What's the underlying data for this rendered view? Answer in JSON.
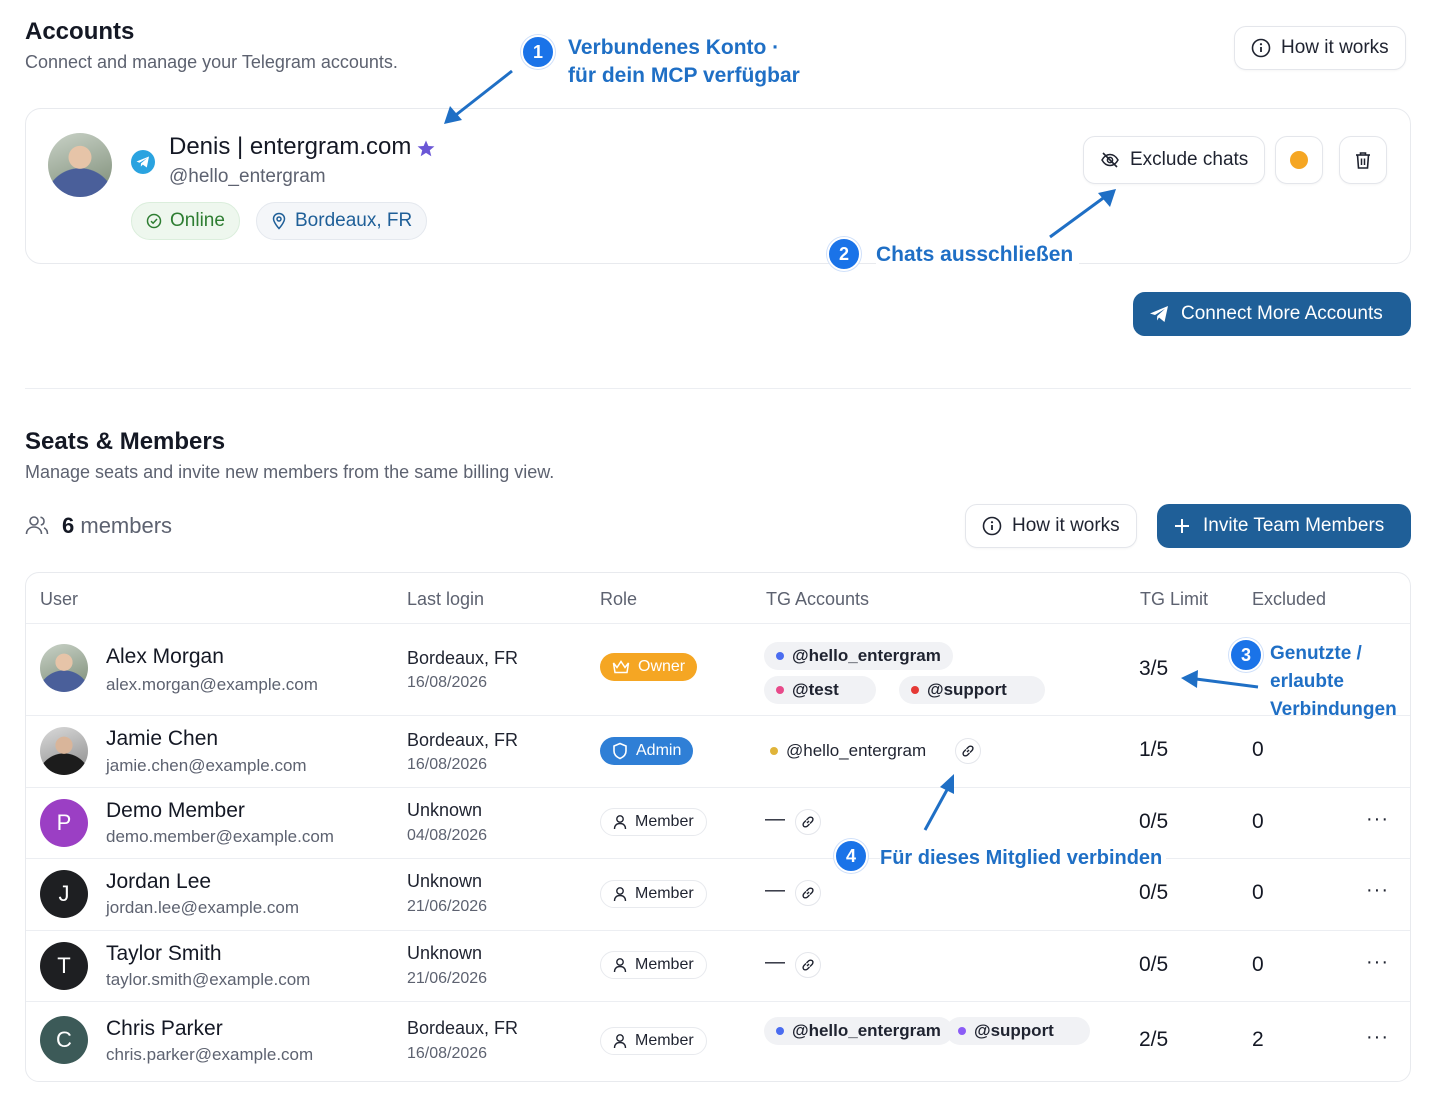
{
  "accounts": {
    "title": "Accounts",
    "subtitle": "Connect and manage your Telegram accounts.",
    "how_it_works": "How it works",
    "account": {
      "name": "Denis | entergram.com",
      "handle": "@hello_entergram",
      "status": "Online",
      "location": "Bordeaux, FR",
      "exclude_label": "Exclude chats",
      "status_dot_color": "#f5a623"
    },
    "connect_more": "Connect More Accounts"
  },
  "seats": {
    "title": "Seats & Members",
    "subtitle": "Manage seats and invite new members from the same billing view.",
    "member_count": "6",
    "member_word": "members",
    "how_it_works": "How it works",
    "invite": "Invite Team Members",
    "columns": [
      "User",
      "Last login",
      "Role",
      "TG Accounts",
      "TG Limit",
      "Excluded"
    ],
    "rows": [
      {
        "name": "Alex Morgan",
        "email": "alex.morgan@example.com",
        "location": "Bordeaux, FR",
        "date": "16/08/2026",
        "role": "Owner",
        "accounts": [
          "@hello_entergram",
          "@test",
          "@support"
        ],
        "limit": "3/5",
        "excluded": ""
      },
      {
        "name": "Jamie Chen",
        "email": "jamie.chen@example.com",
        "location": "Bordeaux, FR",
        "date": "16/08/2026",
        "role": "Admin",
        "accounts": [
          "@hello_entergram"
        ],
        "limit": "1/5",
        "excluded": "0"
      },
      {
        "name": "Demo Member",
        "email": "demo.member@example.com",
        "initial": "P",
        "location": "Unknown",
        "date": "04/08/2026",
        "role": "Member",
        "dash": "—",
        "limit": "0/5",
        "excluded": "0",
        "more": "···"
      },
      {
        "name": "Jordan Lee",
        "email": "jordan.lee@example.com",
        "initial": "J",
        "location": "Unknown",
        "date": "21/06/2026",
        "role": "Member",
        "dash": "—",
        "limit": "0/5",
        "excluded": "0",
        "more": "···"
      },
      {
        "name": "Taylor Smith",
        "email": "taylor.smith@example.com",
        "initial": "T",
        "location": "Unknown",
        "date": "21/06/2026",
        "role": "Member",
        "dash": "—",
        "limit": "0/5",
        "excluded": "0",
        "more": "···"
      },
      {
        "name": "Chris Parker",
        "email": "chris.parker@example.com",
        "initial": "C",
        "location": "Bordeaux, FR",
        "date": "16/08/2026",
        "role": "Member",
        "accounts": [
          "@hello_entergram",
          "@support"
        ],
        "limit": "2/5",
        "excluded": "2",
        "more": "···"
      }
    ]
  },
  "annotations": {
    "a1_num": "1",
    "a1_line1": "Verbundenes Konto ·",
    "a1_line2": "für dein MCP verfügbar",
    "a2_num": "2",
    "a2_text": "Chats ausschließen",
    "a3_num": "3",
    "a3_line1": "Genutzte / erlaubte",
    "a3_line2": "Verbindungen",
    "a4_num": "4",
    "a4_text": "Für dieses Mitglied verbinden"
  },
  "colors": {
    "primary": "#1f5f98",
    "annotation": "#1a73e8",
    "owner": "#f5a623",
    "admin": "#2f7fd6",
    "online_bg": "#eef7ee",
    "online_text": "#2e7d32",
    "location_text": "#1f5f98"
  }
}
